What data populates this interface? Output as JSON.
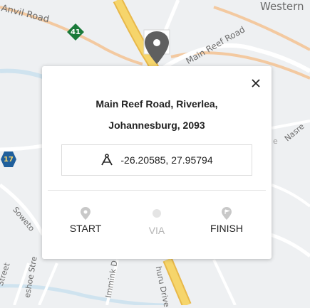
{
  "map": {
    "road_labels": [
      {
        "id": "anvil-road",
        "text": "Anvil Road"
      },
      {
        "id": "western",
        "text": "Western"
      },
      {
        "id": "main-reef-road",
        "text": "Main Reef Road"
      },
      {
        "id": "nasrec",
        "text": "Nasre"
      },
      {
        "id": "soweto",
        "text": "Soweto"
      },
      {
        "id": "street",
        "text": "Street"
      },
      {
        "id": "eshoe",
        "text": "eshoe Stre"
      },
      {
        "id": "immink",
        "text": "Immink D"
      },
      {
        "id": "nuru-drive",
        "text": "huru Drive"
      },
      {
        "id": "faint-e",
        "text": "e"
      }
    ],
    "shields": [
      {
        "id": "route-41",
        "text": "41",
        "color": "#1a7a3a"
      },
      {
        "id": "route-17",
        "text": "17",
        "color": "#1f5f9c"
      }
    ],
    "colors": {
      "background": "#eef0f2",
      "highway": "#f6d56b",
      "highway_edge": "#e8b84a",
      "arterial": "#f3c9a0",
      "road": "#ffffff",
      "water": "#cfe3ef",
      "marker": "#5f5f5f"
    }
  },
  "popup": {
    "address_line1": "Main Reef Road, Riverlea,",
    "address_line2": "Johannesburg, 2093",
    "coordinates": "-26.20585, 27.95794",
    "close_icon": "close-icon",
    "coord_icon": "compass-icon",
    "buttons": {
      "start": {
        "label": "START",
        "enabled": true
      },
      "via": {
        "label": "VIA",
        "enabled": false
      },
      "finish": {
        "label": "FINISH",
        "enabled": true
      }
    },
    "colors": {
      "text": "#222222",
      "disabled_text": "#b5b5b5",
      "pin": "#c8c8c8"
    }
  }
}
